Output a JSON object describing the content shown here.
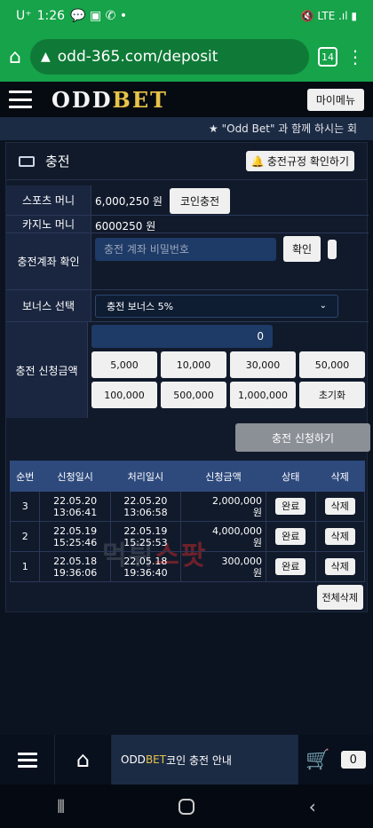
{
  "status": {
    "carrier": "U⁺",
    "time": "1:26",
    "notif_icons": "💬 ▣ ✆ •",
    "signal": "🔇 LTE .ıl ▮"
  },
  "browser": {
    "url": "odd-365.com/deposit",
    "tab_count": "14"
  },
  "topnav": {
    "logo_odd": "ODD",
    "logo_bet": "BET",
    "my_menu": "마이메뉴"
  },
  "ticker": "★ \"Odd Bet\" 과 함께 하시는 회",
  "panel": {
    "title": "충전",
    "rules_button": "충전규정 확인하기"
  },
  "form": {
    "sports_label": "스포츠 머니",
    "sports_value": "6,000,250 원",
    "coin_button": "코인충전",
    "casino_label": "카지노 머니",
    "casino_value": "6000250 원",
    "account_label": "충전계좌 확인",
    "account_placeholder": "충전 계좌 비밀번호",
    "confirm_button": "확인",
    "bonus_label": "보너스 선택",
    "bonus_value": "충전 보너스 5%",
    "amount_label": "충전 신청금액",
    "amount_value": "0",
    "amount_buttons": [
      "5,000",
      "10,000",
      "30,000",
      "50,000",
      "100,000",
      "500,000",
      "1,000,000",
      "초기화"
    ],
    "apply_button": "충전 신청하기"
  },
  "history": {
    "headers": [
      "순번",
      "신청일시",
      "처리일시",
      "신청금액",
      "상태",
      "삭제"
    ],
    "rows": [
      {
        "no": "3",
        "req1": "22.05.20",
        "req2": "13:06:41",
        "proc1": "22.05.20",
        "proc2": "13:06:58",
        "amt1": "2,000,000",
        "amt2": "원",
        "status": "완료",
        "del": "삭제"
      },
      {
        "no": "2",
        "req1": "22.05.19",
        "req2": "15:25:46",
        "proc1": "22.05.19",
        "proc2": "15:25:53",
        "amt1": "4,000,000",
        "amt2": "원",
        "status": "완료",
        "del": "삭제"
      },
      {
        "no": "1",
        "req1": "22.05.18",
        "req2": "19:36:06",
        "proc1": "22.05.18",
        "proc2": "19:36:40",
        "amt1": "300,000",
        "amt2": "원",
        "status": "완료",
        "del": "삭제"
      }
    ],
    "delete_all": "전체삭제"
  },
  "watermark": {
    "left": "먹튀",
    "right": "스팟"
  },
  "bottombar": {
    "info_odd": "ODD ",
    "info_bet": "BET",
    "info_rest": " 코인 충전 안내",
    "cart_count": "0"
  }
}
